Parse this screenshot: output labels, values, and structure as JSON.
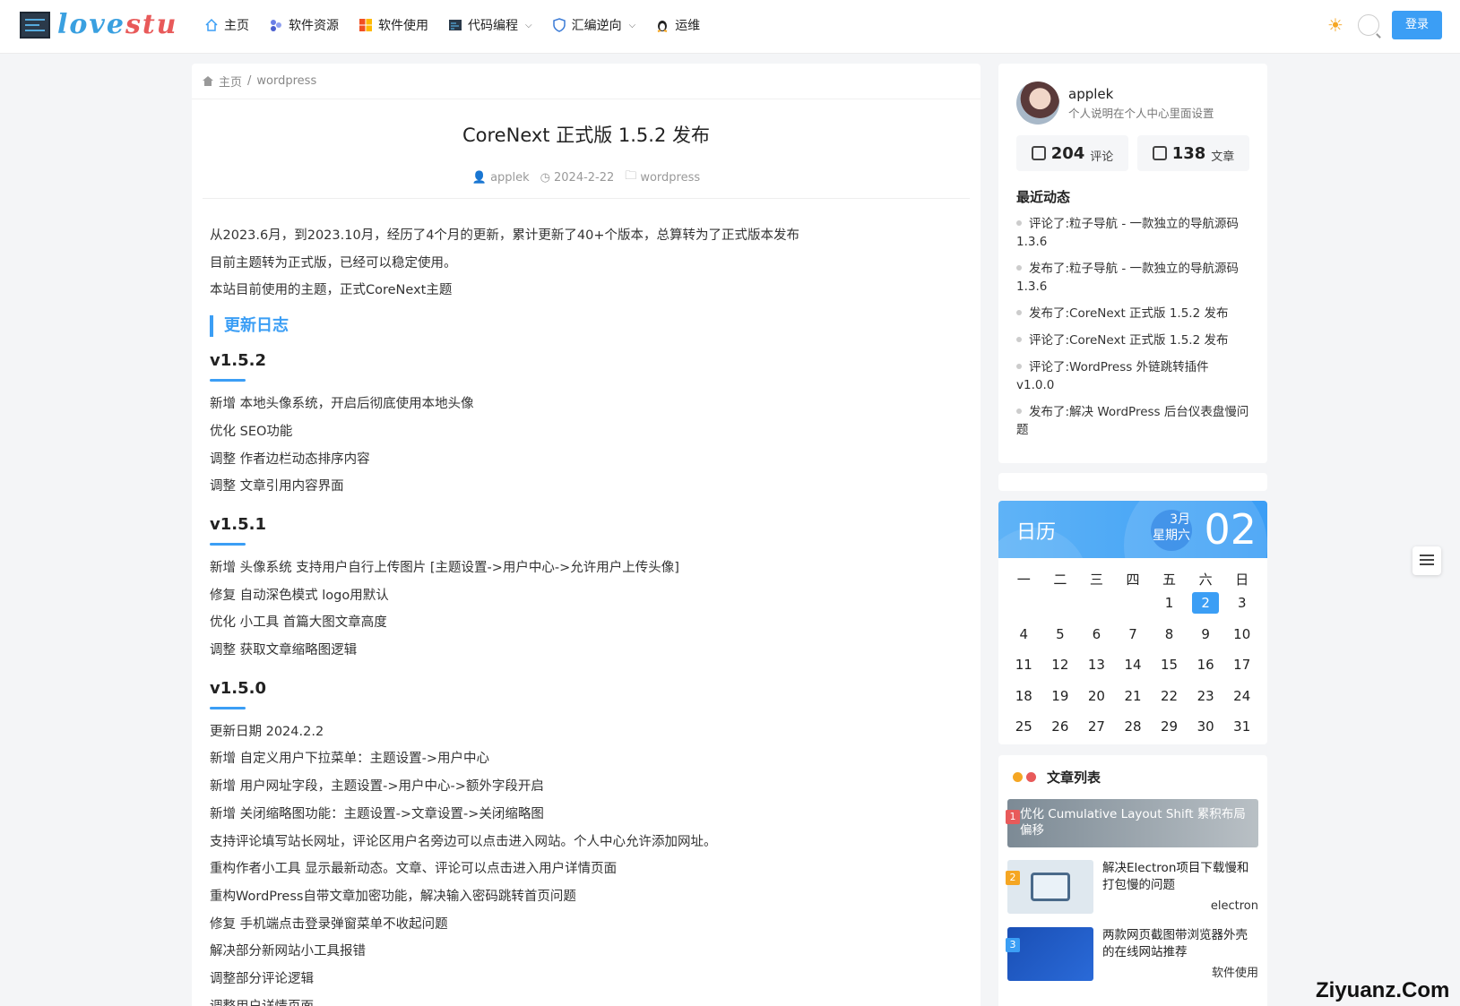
{
  "brand": {
    "logo_text_a": "love",
    "logo_text_b": "stu",
    "accent": "#3b9ef5"
  },
  "nav": {
    "items": [
      {
        "label": "主页",
        "icon": "home-icon"
      },
      {
        "label": "软件资源",
        "icon": "apps-icon"
      },
      {
        "label": "软件使用",
        "icon": "windows-icon"
      },
      {
        "label": "代码编程",
        "icon": "terminal-icon",
        "dropdown": true
      },
      {
        "label": "汇编逆向",
        "icon": "shield-icon",
        "dropdown": true
      },
      {
        "label": "运维",
        "icon": "penguin-icon"
      }
    ],
    "login_label": "登录"
  },
  "breadcrumb": {
    "home": "主页",
    "sep": "/",
    "current": "wordpress"
  },
  "article": {
    "title": "CoreNext 正式版 1.5.2 发布",
    "author": "applek",
    "date": "2024-2-22",
    "category": "wordpress",
    "intro": [
      "从2023.6月，到2023.10月，经历了4个月的更新，累计更新了40+个版本，总算转为了正式版本发布",
      "目前主题转为正式版，已经可以稳定使用。",
      "本站目前使用的主题，正式CoreNext主题"
    ],
    "section_heading": "更新日志",
    "v152": {
      "title": "v1.5.2",
      "items": [
        "新增 本地头像系统，开启后彻底使用本地头像",
        "优化 SEO功能",
        "调整 作者边栏动态排序内容",
        "调整 文章引用内容界面"
      ]
    },
    "v151": {
      "title": "v1.5.1",
      "items": [
        "新增 头像系统 支持用户自行上传图片 [主题设置->用户中心->允许用户上传头像]",
        "修复 自动深色模式 logo用默认",
        "优化 小工具 首篇大图文章高度",
        "调整 获取文章缩略图逻辑"
      ]
    },
    "v150": {
      "title": "v1.5.0",
      "items": [
        "更新日期 2024.2.2",
        "新增 自定义用户下拉菜单：主题设置->用户中心",
        "新增 用户网址字段，主题设置->用户中心->额外字段开启",
        "新增 关闭缩略图功能：主题设置->文章设置->关闭缩略图",
        "支持评论填写站长网址，评论区用户名旁边可以点击进入网站。个人中心允许添加网址。",
        "重构作者小工具 显示最新动态。文章、评论可以点击进入用户详情页面",
        "重构WordPress自带文章加密功能，解决输入密码跳转首页问题",
        "修复 手机端点击登录弹窗菜单不收起问题",
        "解决部分新网站小工具报错",
        "调整部分评论逻辑",
        "调整用户详情页面"
      ]
    }
  },
  "author_card": {
    "name": "applek",
    "desc": "个人说明在个人中心里面设置",
    "comments_count": "204",
    "comments_label": "评论",
    "posts_count": "138",
    "posts_label": "文章",
    "recent_heading": "最近动态",
    "recent": [
      "评论了:粒子导航 - 一款独立的导航源码 1.3.6",
      "发布了:粒子导航 - 一款独立的导航源码 1.3.6",
      "发布了:CoreNext 正式版 1.5.2 发布",
      "评论了:CoreNext 正式版 1.5.2 发布",
      "评论了:WordPress 外链跳转插件 v1.0.0",
      "发布了:解决 WordPress 后台仪表盘慢问题"
    ]
  },
  "calendar": {
    "title": "日历",
    "month": "3月",
    "weekday": "星期六",
    "day": "02",
    "week_headers": [
      "一",
      "二",
      "三",
      "四",
      "五",
      "六",
      "日"
    ],
    "days": [
      "",
      "",
      "",
      "",
      "1",
      "2",
      "3",
      "4",
      "5",
      "6",
      "7",
      "8",
      "9",
      "10",
      "11",
      "12",
      "13",
      "14",
      "15",
      "16",
      "17",
      "18",
      "19",
      "20",
      "21",
      "22",
      "23",
      "24",
      "25",
      "26",
      "27",
      "28",
      "29",
      "30",
      "31"
    ],
    "today": "2"
  },
  "article_list": {
    "heading": "文章列表",
    "items": [
      {
        "rank": "1",
        "title": "优化 Cumulative Layout Shift 累积布局偏移",
        "tag": ""
      },
      {
        "rank": "2",
        "title": "解决Electron项目下载慢和打包慢的问题",
        "tag": "electron"
      },
      {
        "rank": "3",
        "title": "两款网页截图带浏览器外壳的在线网站推荐",
        "tag": "软件使用"
      }
    ]
  },
  "watermark": "Ziyuanz.Com"
}
